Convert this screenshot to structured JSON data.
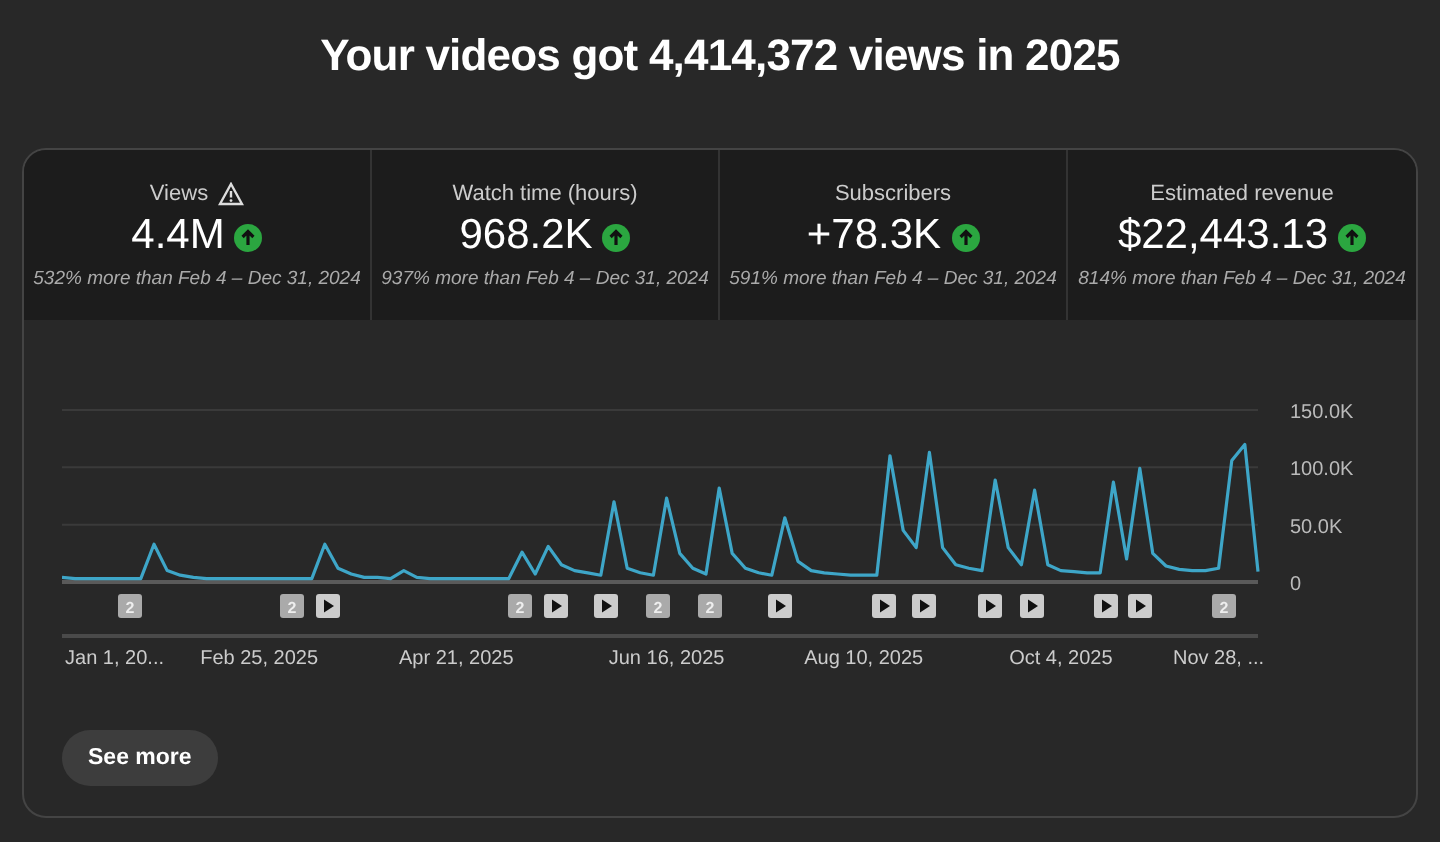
{
  "headline": "Your videos got 4,414,372 views in 2025",
  "metrics": [
    {
      "label": "Views",
      "value": "4.4M",
      "warning": true,
      "trend_up": true,
      "comparison": "532% more than Feb 4 – Dec 31, 2024"
    },
    {
      "label": "Watch time (hours)",
      "value": "968.2K",
      "warning": false,
      "trend_up": true,
      "comparison": "937% more than Feb 4 – Dec 31, 2024"
    },
    {
      "label": "Subscribers",
      "value": "+78.3K",
      "warning": false,
      "trend_up": true,
      "comparison": "591% more than Feb 4 – Dec 31, 2024"
    },
    {
      "label": "Estimated revenue",
      "value": "$22,443.13",
      "warning": false,
      "trend_up": true,
      "comparison": "814% more than Feb 4 – Dec 31, 2024"
    }
  ],
  "chart_data": {
    "type": "line",
    "ylim": [
      0,
      150000
    ],
    "yticks": [
      {
        "value": 0,
        "label": "0"
      },
      {
        "value": 50000,
        "label": "50.0K"
      },
      {
        "value": 100000,
        "label": "100.0K"
      },
      {
        "value": 150000,
        "label": "150.0K"
      }
    ],
    "categories": [
      null,
      null,
      null,
      null,
      "Jan 1, 20...",
      null,
      null,
      null,
      null,
      null,
      null,
      null,
      null,
      null,
      null,
      "Feb 25, 2025",
      null,
      null,
      null,
      null,
      null,
      null,
      null,
      null,
      null,
      null,
      null,
      null,
      null,
      null,
      "Apr 21, 2025",
      null,
      null,
      null,
      null,
      null,
      null,
      null,
      null,
      null,
      null,
      null,
      null,
      null,
      null,
      null,
      "Jun 16, 2025",
      null,
      null,
      null,
      null,
      null,
      null,
      null,
      null,
      null,
      null,
      null,
      null,
      null,
      null,
      "Aug 10, 2025",
      null,
      null,
      null,
      null,
      null,
      null,
      null,
      null,
      null,
      null,
      null,
      null,
      null,
      null,
      "Oct 4, 2025",
      null,
      null,
      null,
      null,
      null,
      null,
      null,
      null,
      null,
      null,
      null,
      "Nov 28, ...",
      null,
      null,
      null
    ],
    "series": [
      {
        "color": "#3ea6c8",
        "values": [
          4000,
          3000,
          3000,
          3000,
          3000,
          3000,
          3000,
          33000,
          10000,
          6000,
          4000,
          3000,
          3000,
          3000,
          3000,
          3000,
          3000,
          3000,
          3000,
          3000,
          33000,
          12000,
          7000,
          4000,
          4000,
          3000,
          10000,
          4000,
          3000,
          3000,
          3000,
          3000,
          3000,
          3000,
          3000,
          26000,
          7000,
          31000,
          15000,
          10000,
          8000,
          6000,
          70000,
          12000,
          8000,
          6000,
          73000,
          25000,
          12000,
          7000,
          82000,
          25000,
          12000,
          8000,
          6000,
          56000,
          18000,
          10000,
          8000,
          7000,
          6000,
          6000,
          6000,
          110000,
          45000,
          30000,
          113000,
          30000,
          15000,
          12000,
          10000,
          89000,
          30000,
          15000,
          80000,
          15000,
          10000,
          9000,
          8000,
          8000,
          87000,
          20000,
          99000,
          25000,
          14000,
          11000,
          10000,
          10000,
          12000,
          106000,
          120000,
          9000
        ]
      }
    ]
  },
  "markers": [
    {
      "kind": "count",
      "label": "2"
    },
    {
      "kind": "count",
      "label": "2"
    },
    {
      "kind": "video"
    },
    {
      "kind": "count",
      "label": "2"
    },
    {
      "kind": "video"
    },
    {
      "kind": "video"
    },
    {
      "kind": "count",
      "label": "2"
    },
    {
      "kind": "count",
      "label": "2"
    },
    {
      "kind": "video"
    },
    {
      "kind": "video"
    },
    {
      "kind": "video"
    },
    {
      "kind": "video"
    },
    {
      "kind": "video"
    },
    {
      "kind": "video"
    },
    {
      "kind": "video"
    },
    {
      "kind": "count",
      "label": "2"
    }
  ],
  "see_more": "See more"
}
